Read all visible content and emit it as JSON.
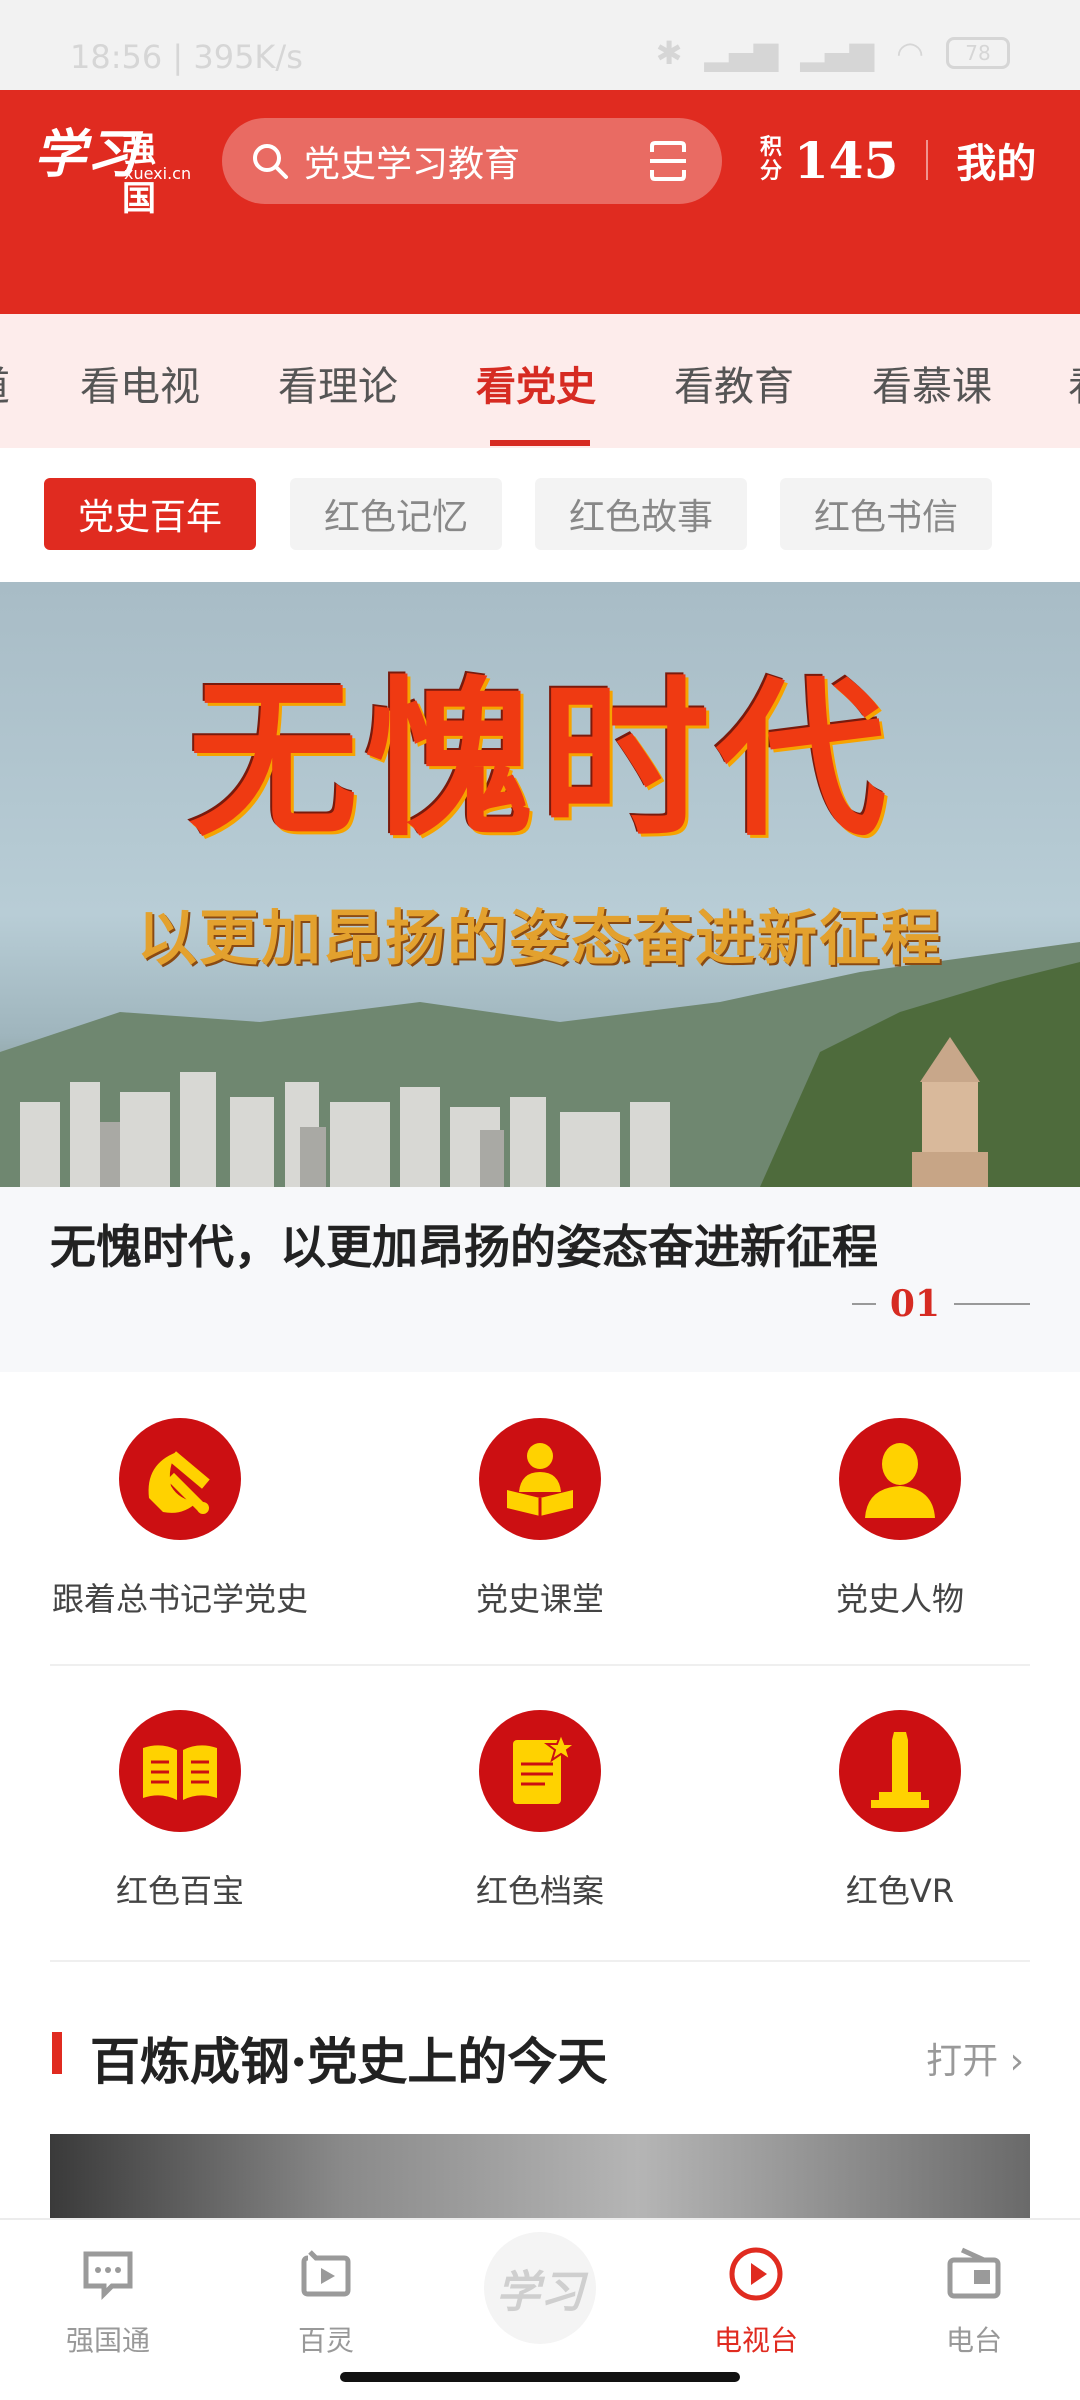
{
  "status_bar": {
    "time": "18:56 | 395K/s",
    "battery": "78"
  },
  "header": {
    "logo_calligraphy": "学习",
    "logo_name": "强国",
    "logo_domain": "xuexi.cn",
    "search_placeholder": "党史学习教育",
    "points_label": "积分",
    "points_value": "145",
    "mine_label": "我的"
  },
  "category_tabs": [
    {
      "label": "看电视"
    },
    {
      "label": "看理论"
    },
    {
      "label": "看党史",
      "active": true
    },
    {
      "label": "看教育"
    },
    {
      "label": "看慕课"
    }
  ],
  "sub_tabs": [
    {
      "label": "党史百年",
      "active": true
    },
    {
      "label": "红色记忆"
    },
    {
      "label": "红色故事"
    },
    {
      "label": "红色书信"
    }
  ],
  "banner": {
    "title_art": "无愧时代",
    "subtitle_art": "以更加昂扬的姿态奋进新征程",
    "caption": "无愧时代，以更加昂扬的姿态奋进新征程",
    "page_index": "01"
  },
  "features": [
    {
      "label": "跟着总书记学党史",
      "icon": "hammer-sickle-icon"
    },
    {
      "label": "党史课堂",
      "icon": "reader-icon"
    },
    {
      "label": "党史人物",
      "icon": "person-icon"
    },
    {
      "label": "红色百宝",
      "icon": "open-book-icon"
    },
    {
      "label": "红色档案",
      "icon": "document-star-icon"
    },
    {
      "label": "红色VR",
      "icon": "monument-icon"
    }
  ],
  "section": {
    "title": "百炼成钢·党史上的今天",
    "more_label": "打开"
  },
  "bottom_nav": [
    {
      "label": "强国通",
      "icon": "chat-icon"
    },
    {
      "label": "百灵",
      "icon": "play-square-icon"
    },
    {
      "label": "电视台",
      "icon": "play-circle-icon",
      "active": true
    },
    {
      "label": "电台",
      "icon": "radio-icon"
    }
  ],
  "bottom_center_label": "学习",
  "colors": {
    "brand_red": "#e02b20",
    "icon_red": "#cc0f12",
    "icon_yellow": "#ffd200"
  }
}
